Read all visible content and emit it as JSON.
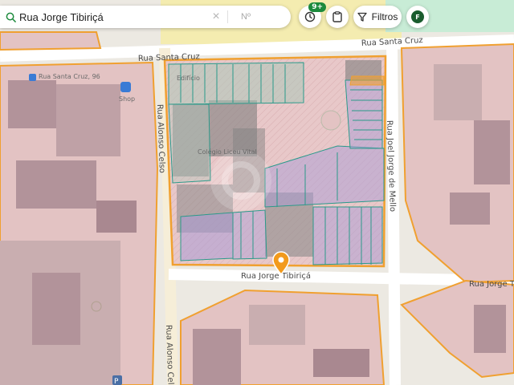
{
  "search": {
    "value": "Rua Jorge Tibiriçá",
    "number_placeholder": "Nº"
  },
  "toolbar": {
    "history_badge": "9+",
    "filters_label": "Filtros",
    "profile_initial": "F"
  },
  "map": {
    "streets": {
      "santa_cruz_top": "Rua Santa Cruz",
      "santa_cruz_left": "Rua Santa Cruz",
      "santa_cruz_96": "Rua Santa Cruz, 96",
      "alonso_celso_top": "Rua Alonso Celso",
      "alonso_celso_bottom": "Rua Alonso Celso",
      "joel_jorge_de_mello": "Rua Joel Jorge de Mello",
      "jorge_tibirica": "Rua Jorge Tibiriçá",
      "jorge_tibirica_right": "Rua Jorge Tibiriçá"
    },
    "pois": {
      "colegio": "Colégio Liceu Vital",
      "edificio": "Edifício",
      "shop": "Shop"
    },
    "colors": {
      "lot_fill": "#e2bfc0",
      "lot_border": "#f0a030",
      "building": "#b2939a",
      "selected_fill": "#8a9a8e",
      "subdivision_blue": "#a99bd6",
      "subdivision_line": "#2a9a8a",
      "pin": "#f29a1c",
      "accent_green": "#1c8a3c"
    }
  }
}
